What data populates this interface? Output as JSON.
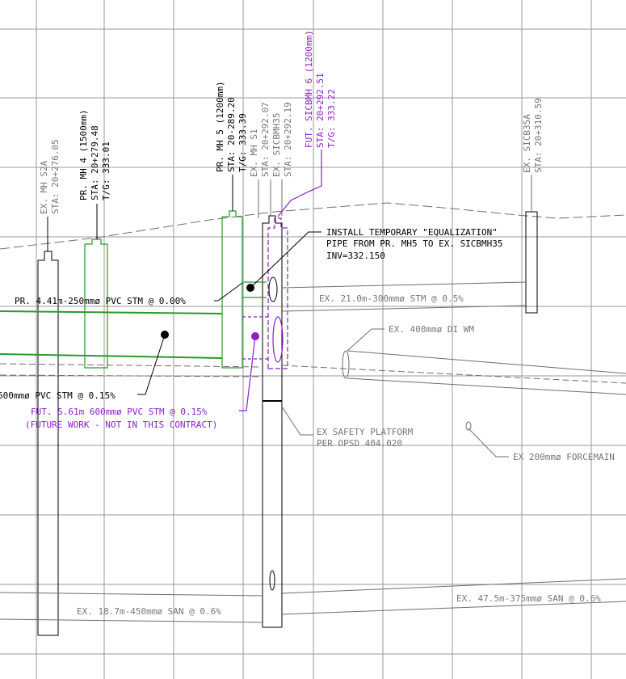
{
  "colors": {
    "proposed": "#000000",
    "existing": "#777777",
    "future": "#8a1fc9",
    "proposed_pipe": "#2a9a2a",
    "grid": "#9a9a9a"
  },
  "structures": {
    "ex_mh_s2a": {
      "name": "EX. MH S2A",
      "sta": "STA: 20+276.05"
    },
    "pr_mh4": {
      "name": "PR. MH 4 (1500mm)",
      "sta": "STA: 20+279.48",
      "tg": "T/G: 333.01"
    },
    "pr_mh5": {
      "name": "PR. MH 5 (1200mm)",
      "sta": "STA: 20-289.20",
      "tg": "T/G: 333.39"
    },
    "ex_mh_s1": {
      "name": "EX. MH S1",
      "sta": "STA: 20+292.07"
    },
    "ex_sicbmh35": {
      "name": "EX. SICBMH35",
      "sta": "STA: 20+292.19"
    },
    "fut_sicbmh6": {
      "name": "FUT. SICBMH 6 (1200mm)",
      "sta": "STA: 20+292.51",
      "tg": "T/G: 333.22"
    },
    "ex_sicb35a": {
      "name": "EX. SICB35A",
      "sta": "STA: 20+310.59"
    }
  },
  "notes": {
    "equalization": [
      "INSTALL TEMPORARY \"EQUALIZATION\"",
      "PIPE FROM PR. MH5 TO EX. SICBMH35",
      "INV=332.150"
    ],
    "pr_pvc_250": "PR. 4.41m-250mmø PVC STM @ 0.00%",
    "pr_pvc_600": "600mmø PVC STM @ 0.15%",
    "fut_pvc_600": "FUT. 5.61m 600mmø PVC STM @ 0.15%",
    "future_work": "(FUTURE WORK - NOT IN THIS CONTRACT)",
    "ex_stm_300": "EX. 21.0m-300mmø STM @ 0.5%",
    "ex_wm": "EX. 400mmø DI WM",
    "safety": [
      "EX SAFETY PLATFORM",
      "PER OPSD 404.020"
    ],
    "forcemain": "EX 200mmø FORCEMAIN",
    "san_450": "EX. 18.7m-450mmø SAN @ 0.6%",
    "san_375": "EX. 47.5m-375mmø SAN @ 0.6%"
  }
}
